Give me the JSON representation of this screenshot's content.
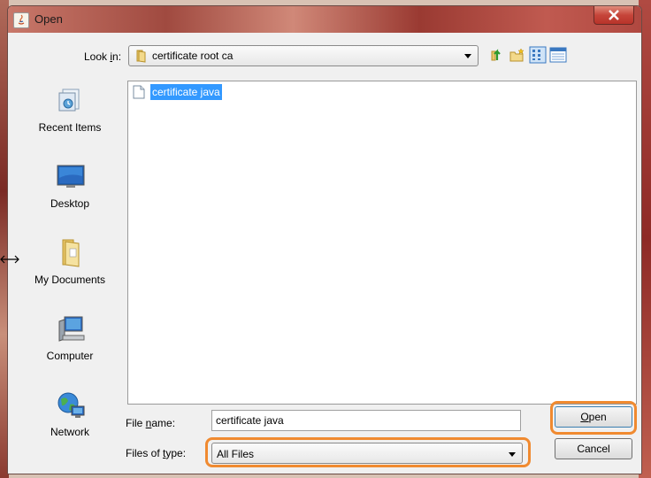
{
  "window": {
    "title": "Open"
  },
  "toolbar": {
    "look_in_label_pre": "Look ",
    "look_in_label_mn": "i",
    "look_in_label_post": "n:",
    "look_in_value": "certificate root ca",
    "buttons": [
      "up-one-level-icon",
      "create-new-folder-icon",
      "list-view-icon",
      "details-view-icon"
    ]
  },
  "places": [
    {
      "label": "Recent Items",
      "icon": "recent-items-icon"
    },
    {
      "label": "Desktop",
      "icon": "desktop-icon"
    },
    {
      "label": "My Documents",
      "icon": "my-documents-icon"
    },
    {
      "label": "Computer",
      "icon": "computer-icon"
    },
    {
      "label": "Network",
      "icon": "network-icon"
    }
  ],
  "files": [
    {
      "name": "certificate java",
      "selected": true
    }
  ],
  "form": {
    "file_name_label_pre": "File ",
    "file_name_label_mn": "n",
    "file_name_label_post": "ame:",
    "file_name_value": "certificate java",
    "files_of_type_label_pre": "Files of ",
    "files_of_type_label_mn": "t",
    "files_of_type_label_post": "ype:",
    "files_of_type_value": "All Files"
  },
  "buttons": {
    "open_mn": "O",
    "open_rest": "pen",
    "cancel": "Cancel"
  },
  "colors": {
    "selection": "#3399ff",
    "highlight": "#f08a30",
    "close_button": "#c6453a"
  }
}
